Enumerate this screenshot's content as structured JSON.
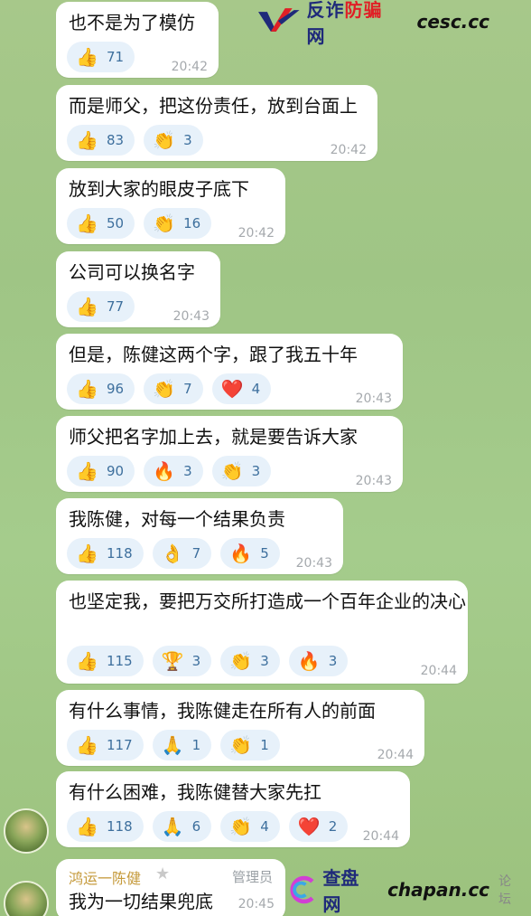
{
  "watermarks": {
    "top": {
      "brand_part1": "反诈",
      "brand_part2": "防骗",
      "brand_part3": "网",
      "domain": "cesc.cc"
    },
    "bottom": {
      "brand": "查盘网",
      "domain": "chapan.cc",
      "forum": "论坛"
    }
  },
  "messages": [
    {
      "text": "也不是为了模仿",
      "time": "20:42",
      "reactions": [
        {
          "icon": "thumbs-up",
          "emoji": "👍",
          "count": "71"
        }
      ]
    },
    {
      "text": "而是师父，把这份责任，放到台面上",
      "time": "20:42",
      "reactions": [
        {
          "icon": "thumbs-up",
          "emoji": "👍",
          "count": "83"
        },
        {
          "icon": "clap",
          "emoji": "👏",
          "count": "3"
        }
      ]
    },
    {
      "text": "放到大家的眼皮子底下",
      "time": "20:42",
      "reactions": [
        {
          "icon": "thumbs-up",
          "emoji": "👍",
          "count": "50"
        },
        {
          "icon": "clap",
          "emoji": "👏",
          "count": "16"
        }
      ]
    },
    {
      "text": "公司可以换名字",
      "time": "20:43",
      "reactions": [
        {
          "icon": "thumbs-up",
          "emoji": "👍",
          "count": "77"
        }
      ]
    },
    {
      "text": "但是，陈健这两个字，跟了我五十年",
      "time": "20:43",
      "reactions": [
        {
          "icon": "thumbs-up",
          "emoji": "👍",
          "count": "96"
        },
        {
          "icon": "clap",
          "emoji": "👏",
          "count": "7"
        },
        {
          "icon": "heart",
          "emoji": "❤️",
          "count": "4"
        }
      ]
    },
    {
      "text": "师父把名字加上去，就是要告诉大家",
      "time": "20:43",
      "reactions": [
        {
          "icon": "thumbs-up",
          "emoji": "👍",
          "count": "90"
        },
        {
          "icon": "fire",
          "emoji": "🔥",
          "count": "3"
        },
        {
          "icon": "clap",
          "emoji": "👏",
          "count": "3"
        }
      ]
    },
    {
      "text": "我陈健，对每一个结果负责",
      "time": "20:43",
      "reactions": [
        {
          "icon": "thumbs-up",
          "emoji": "👍",
          "count": "118"
        },
        {
          "icon": "ok-hand",
          "emoji": "👌",
          "count": "7"
        },
        {
          "icon": "fire",
          "emoji": "🔥",
          "count": "5"
        }
      ]
    },
    {
      "text": "也坚定我，要把万交所打造成一个百年企业的决心",
      "time": "20:44",
      "reactions": [
        {
          "icon": "thumbs-up",
          "emoji": "👍",
          "count": "115"
        },
        {
          "icon": "trophy",
          "emoji": "🏆",
          "count": "3"
        },
        {
          "icon": "clap",
          "emoji": "👏",
          "count": "3"
        },
        {
          "icon": "fire",
          "emoji": "🔥",
          "count": "3"
        }
      ]
    },
    {
      "text": "有什么事情，我陈健走在所有人的前面",
      "time": "20:44",
      "reactions": [
        {
          "icon": "thumbs-up",
          "emoji": "👍",
          "count": "117"
        },
        {
          "icon": "pray",
          "emoji": "🙏",
          "count": "1"
        },
        {
          "icon": "clap",
          "emoji": "👏",
          "count": "1"
        }
      ]
    },
    {
      "text": "有什么困难，我陈健替大家先扛",
      "time": "20:44",
      "reactions": [
        {
          "icon": "thumbs-up",
          "emoji": "👍",
          "count": "118"
        },
        {
          "icon": "pray",
          "emoji": "🙏",
          "count": "6"
        },
        {
          "icon": "clap",
          "emoji": "👏",
          "count": "4"
        },
        {
          "icon": "heart",
          "emoji": "❤️",
          "count": "2"
        }
      ]
    }
  ],
  "last_message": {
    "sender": "鸿运一陈健",
    "role": "管理员",
    "star_icon": "star-icon",
    "text": "我为一切结果兜底",
    "time": "20:45"
  }
}
